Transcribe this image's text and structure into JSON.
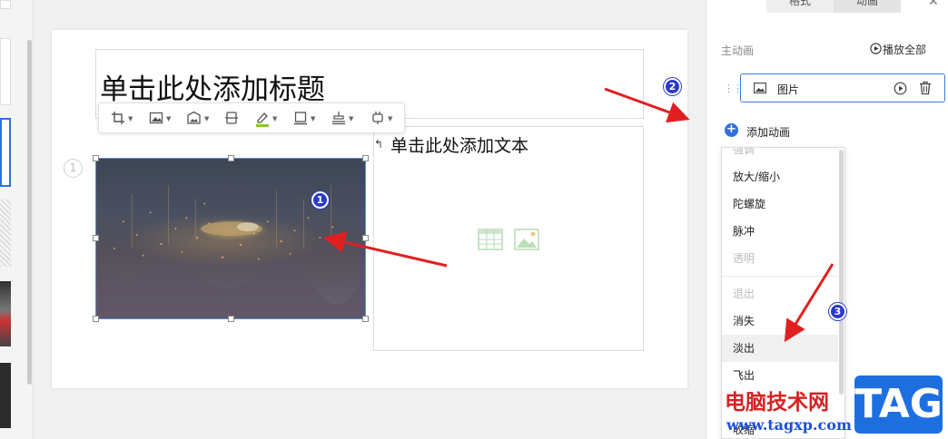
{
  "slide": {
    "title_placeholder": "单击此处添加标题",
    "text_placeholder": "单击此处添加文本",
    "slide_number": "1"
  },
  "toolbar": {
    "tools": [
      "crop-icon",
      "image-icon",
      "image-adjust-icon",
      "align-icon",
      "pen-color-icon",
      "border-icon",
      "distribute-icon",
      "frame-icon"
    ]
  },
  "panel": {
    "tabs": [
      "格式",
      "动画"
    ],
    "active_tab": "动画",
    "main_anim_label": "主动画",
    "play_all": "播放全部",
    "anim_item_label": "图片",
    "add_anim": "添加动画",
    "menu_items": [
      {
        "label": "强调",
        "disabled": true
      },
      {
        "label": "放大/缩小",
        "disabled": false
      },
      {
        "label": "陀螺旋",
        "disabled": false
      },
      {
        "label": "脉冲",
        "disabled": false
      },
      {
        "label": "透明",
        "disabled": true
      },
      {
        "label": "退出",
        "disabled": true
      },
      {
        "label": "消失",
        "disabled": false
      },
      {
        "label": "淡出",
        "disabled": false
      },
      {
        "label": "飞出",
        "disabled": false
      },
      {
        "label": "收缩",
        "disabled": false
      }
    ],
    "hovered_item": "淡出"
  },
  "annotations": {
    "badges": [
      "1",
      "2",
      "3"
    ],
    "arrow_color": "#e02020",
    "badge_color": "#2a3ac8"
  },
  "watermark": {
    "site_name": "电脑技术网",
    "url": "www.tagxp.com",
    "logo_text": "TAG"
  },
  "colors": {
    "accent": "#3a7bd5",
    "add_icon": "#2f6fe0"
  }
}
